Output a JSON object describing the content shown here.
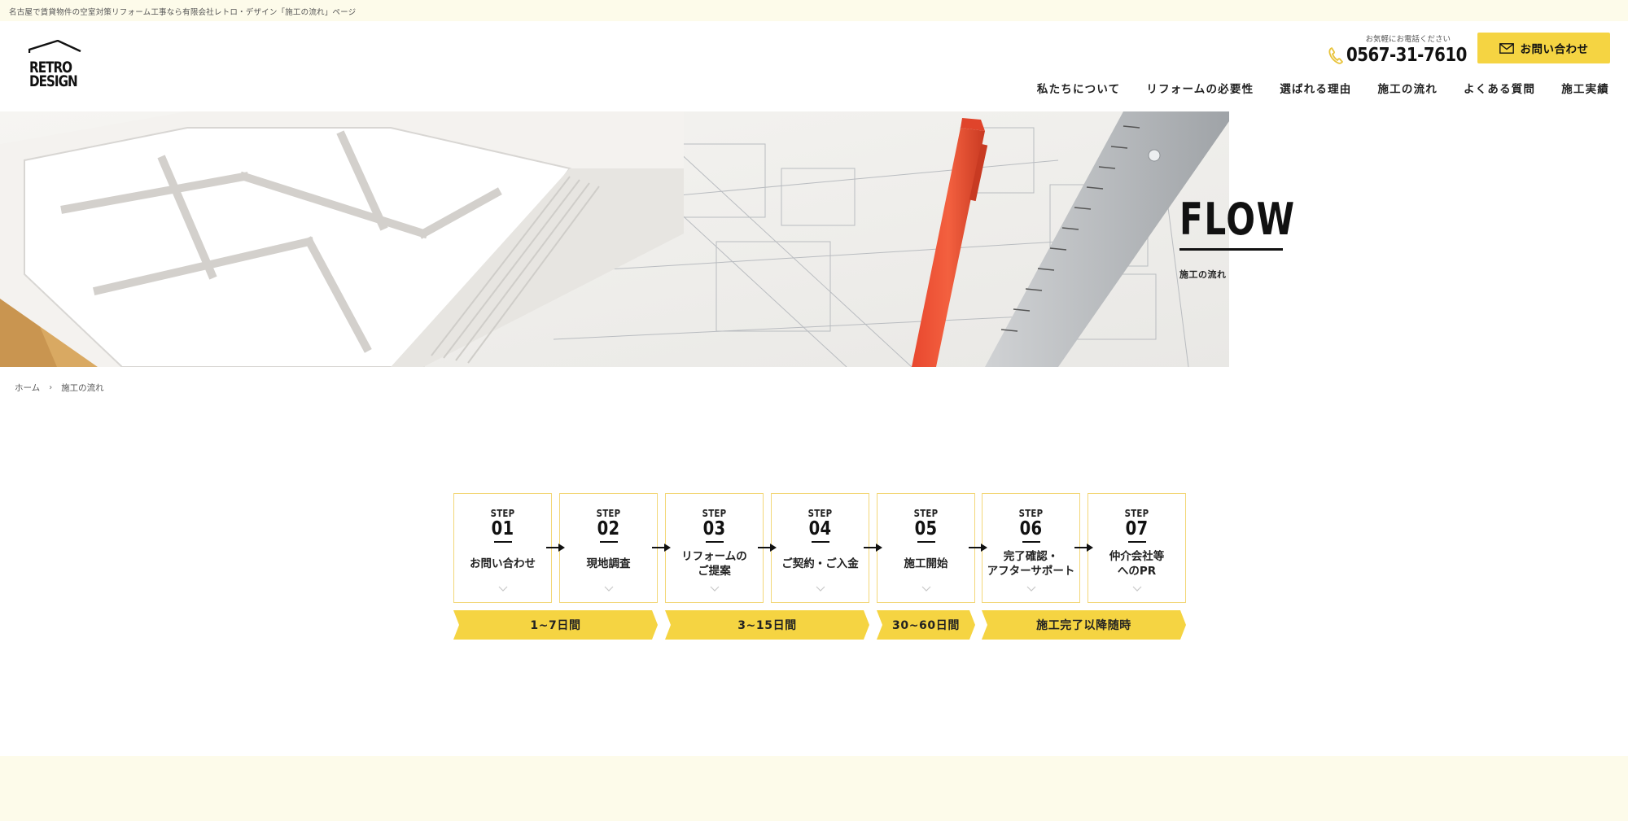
{
  "topbar": {
    "text": "名古屋で賃貸物件の空室対策リフォーム工事なら有限会社レトロ・デザイン「施工の流れ」ページ"
  },
  "logo": {
    "line1": "RETRO",
    "line2": "DESIGN"
  },
  "header": {
    "tel_note": "お気軽にお電話ください",
    "tel_number": "0567-31-7610",
    "contact_label": "お問い合わせ",
    "accent_color": "#f5d442"
  },
  "nav": [
    {
      "label": "私たちについて"
    },
    {
      "label": "リフォームの必要性"
    },
    {
      "label": "選ばれる理由"
    },
    {
      "label": "施工の流れ"
    },
    {
      "label": "よくある質問"
    },
    {
      "label": "施工実績"
    }
  ],
  "hero": {
    "title": "FLOW",
    "subtitle": "施工の流れ"
  },
  "breadcrumb": {
    "home": "ホーム",
    "current": "施工の流れ"
  },
  "flow": {
    "step_word": "STEP",
    "steps": [
      {
        "num": "01",
        "title": "お問い合わせ"
      },
      {
        "num": "02",
        "title": "現地調査"
      },
      {
        "num": "03",
        "title": "リフォームの\nご提案"
      },
      {
        "num": "04",
        "title": "ご契約・ご入金"
      },
      {
        "num": "05",
        "title": "施工開始"
      },
      {
        "num": "06",
        "title": "完了確認・\nアフターサポート"
      },
      {
        "num": "07",
        "title": "仲介会社等\nへのPR"
      }
    ],
    "periods": [
      {
        "label": "1~7日間"
      },
      {
        "label": "3~15日間"
      },
      {
        "label": "30~60日間"
      },
      {
        "label": "施工完了以降随時"
      }
    ]
  }
}
